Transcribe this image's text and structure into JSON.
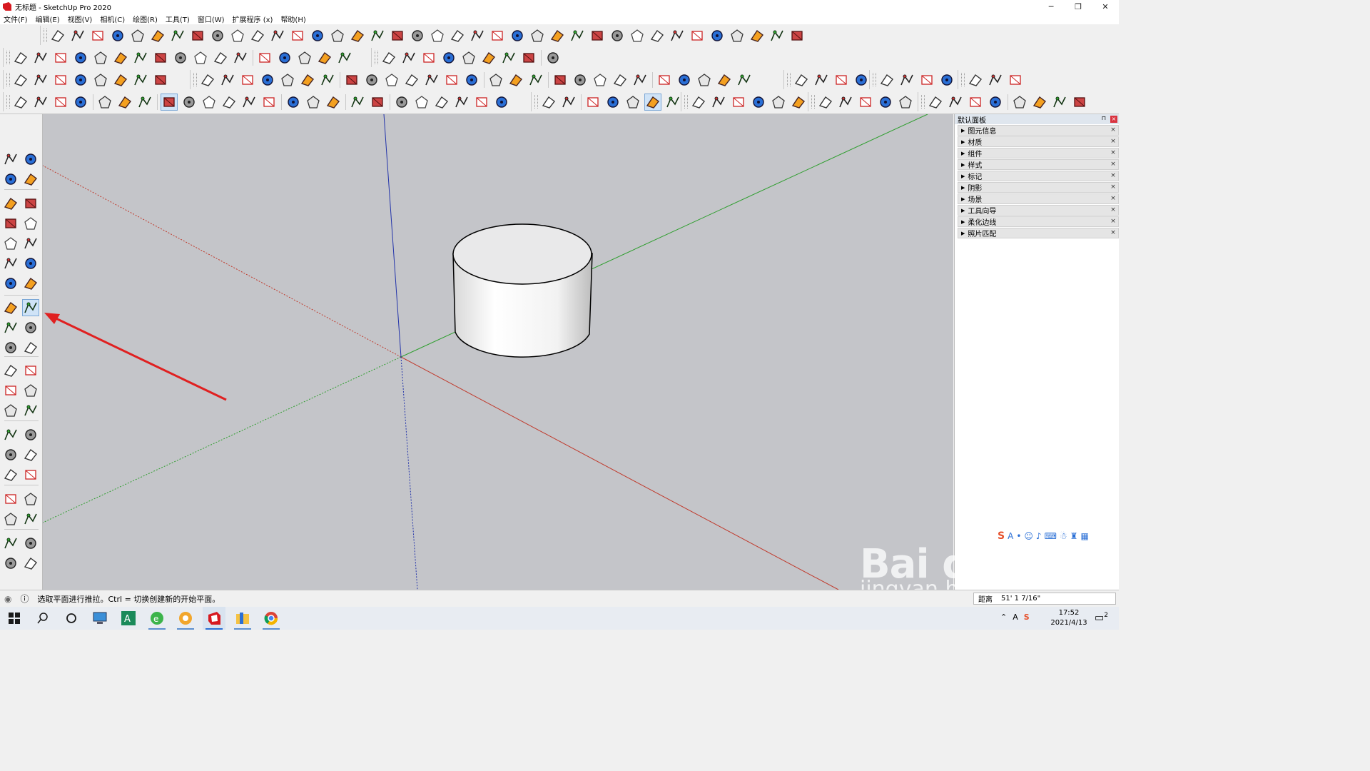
{
  "window": {
    "title": "无标题 - SketchUp Pro 2020",
    "controls": [
      "─",
      "❐",
      "✕"
    ]
  },
  "menu": [
    "文件(F)",
    "编辑(E)",
    "视图(V)",
    "相机(C)",
    "绘图(R)",
    "工具(T)",
    "窗口(W)",
    "扩展程序 (x)",
    "帮助(H)"
  ],
  "tray": {
    "title": "默认面板",
    "sections": [
      "图元信息",
      "材质",
      "组件",
      "样式",
      "标记",
      "阴影",
      "场景",
      "工具向导",
      "柔化边线",
      "照片匹配"
    ]
  },
  "status": {
    "hint": "选取平面进行推拉。Ctrl = 切换创建新的开始平面。",
    "measure_label": "距离",
    "measure_value": "51' 1 7/16\""
  },
  "taskbar": {
    "time": "17:52",
    "date": "2021/4/13",
    "notification_count": "2"
  },
  "watermark": {
    "main": "Bai du 经验",
    "sub": "jingyan.baidu.com"
  },
  "colors": {
    "viewport_bg": "#c4c5c9",
    "axis_red": "#c0392b",
    "axis_green": "#2e9e2e",
    "axis_blue": "#2233aa",
    "annotation_arrow": "#e02020",
    "active_tool_highlight": "#cfe3f7"
  },
  "icons": {
    "active_tool": "push-pull-icon"
  }
}
